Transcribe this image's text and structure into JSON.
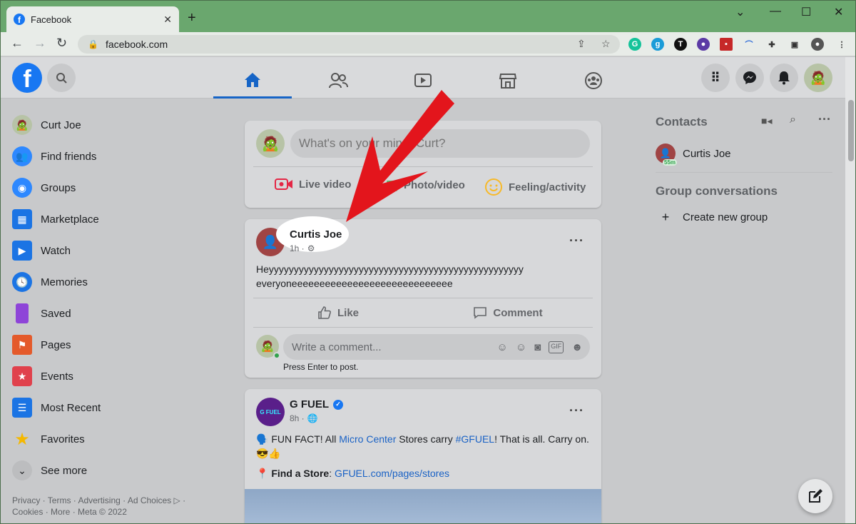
{
  "browser": {
    "tab_title": "Facebook",
    "tab_close": "✕",
    "new_tab": "+",
    "url": "facebook.com",
    "window_controls": [
      "⌄",
      "—",
      "☐",
      "✕"
    ]
  },
  "fb": {
    "logo": "f",
    "nav": [
      "home-icon",
      "friends-icon",
      "watch-icon",
      "marketplace-icon",
      "groups-icon"
    ]
  },
  "left_menu": {
    "items": [
      {
        "label": "Curt Joe",
        "icon": "avatar",
        "color": "#8a8a8a"
      },
      {
        "label": "Find friends",
        "icon": "friends-icon",
        "color": "#2d88ff"
      },
      {
        "label": "Groups",
        "icon": "groups-icon",
        "color": "#2d88ff"
      },
      {
        "label": "Marketplace",
        "icon": "marketplace-icon",
        "color": "#1b74e4"
      },
      {
        "label": "Watch",
        "icon": "watch-icon",
        "color": "#1b74e4"
      },
      {
        "label": "Memories",
        "icon": "memories-icon",
        "color": "#1b74e4"
      },
      {
        "label": "Saved",
        "icon": "saved-icon",
        "color": "#8e44d8"
      },
      {
        "label": "Pages",
        "icon": "pages-icon",
        "color": "#e45a2b"
      },
      {
        "label": "Events",
        "icon": "events-icon",
        "color": "#e0414c"
      },
      {
        "label": "Most Recent",
        "icon": "most-recent-icon",
        "color": "#1b74e4"
      },
      {
        "label": "Favorites",
        "icon": "favorites-icon",
        "color": "#f5b800"
      },
      {
        "label": "See more",
        "icon": "chevron-down-icon",
        "color": "#bcbdbf"
      }
    ],
    "footer": "Privacy · Terms · Advertising · Ad Choices ▷ · Cookies · More · Meta © 2022"
  },
  "composer": {
    "placeholder": "What's on your mind, Curt?",
    "actions": [
      "Live video",
      "Photo/video",
      "Feeling/activity"
    ]
  },
  "post1": {
    "author": "Curtis Joe",
    "time": "1h ·",
    "text_line1": "Heyyyyyyyyyyyyyyyyyyyyyyyyyyyyyyyyyyyyyyyyyyyyyyyyyyy",
    "text_line2": "everyoneeeeeeeeeeeeeeeeeeeeeeeeeeeee",
    "like": "Like",
    "comment": "Comment",
    "comment_placeholder": "Write a comment...",
    "hint": "Press Enter to post."
  },
  "post2": {
    "author": "G FUEL",
    "time": "8h ·",
    "text_a": "🗣️ FUN FACT! All ",
    "link_a": "Micro Center",
    "text_b": " Stores carry ",
    "link_b": "#GFUEL",
    "text_c": "! That is all. Carry on. 😎👍",
    "find_label": "📍 Find a Store",
    "find_sep": ": ",
    "find_link": "GFUEL.com/pages/stores"
  },
  "contacts": {
    "title": "Contacts",
    "person": "Curtis Joe",
    "badge": "55m",
    "groups_title": "Group conversations",
    "create": "Create new group"
  }
}
